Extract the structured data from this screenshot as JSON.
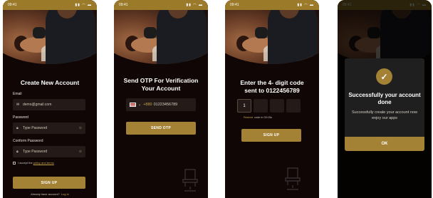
{
  "status": {
    "time": "09:41",
    "icons": "▮▮ ◠ ▬"
  },
  "signup": {
    "title": "Create New Account",
    "email_label": "Email",
    "email_value": "demo@gmail.com",
    "password_label": "Password",
    "password_placeholder": "Type Password",
    "confirm_label": "Conform Password",
    "confirm_placeholder": "Type Password",
    "terms_prefix": "I accept the",
    "terms_link": "policy and terms",
    "button": "SIGN UP",
    "footer_prefix": "Already have account?",
    "footer_link": "Log in"
  },
  "send_otp": {
    "title": "Send OTP For Verification Your Account",
    "country_code": "+880",
    "phone": "01223456789",
    "button": "SEND OTP"
  },
  "verify": {
    "title": "Enter the 4- digit code sent to 0122456789",
    "digits": [
      "1",
      "",
      "",
      ""
    ],
    "resend_link": "Resend",
    "resend_text": "code in 00:15s",
    "button": "SIGN UP"
  },
  "success": {
    "title": "Successfully your account done",
    "message": "Successfully create your account now enjoy our apps",
    "button": "OK"
  },
  "colors": {
    "accent": "#a38235",
    "background": "#0f0605",
    "field": "#241a17"
  },
  "icons": [
    "email-icon",
    "lock-icon",
    "eye-off-icon",
    "flag-icon",
    "chevron-down-icon",
    "check-icon",
    "barber-chair-icon"
  ]
}
